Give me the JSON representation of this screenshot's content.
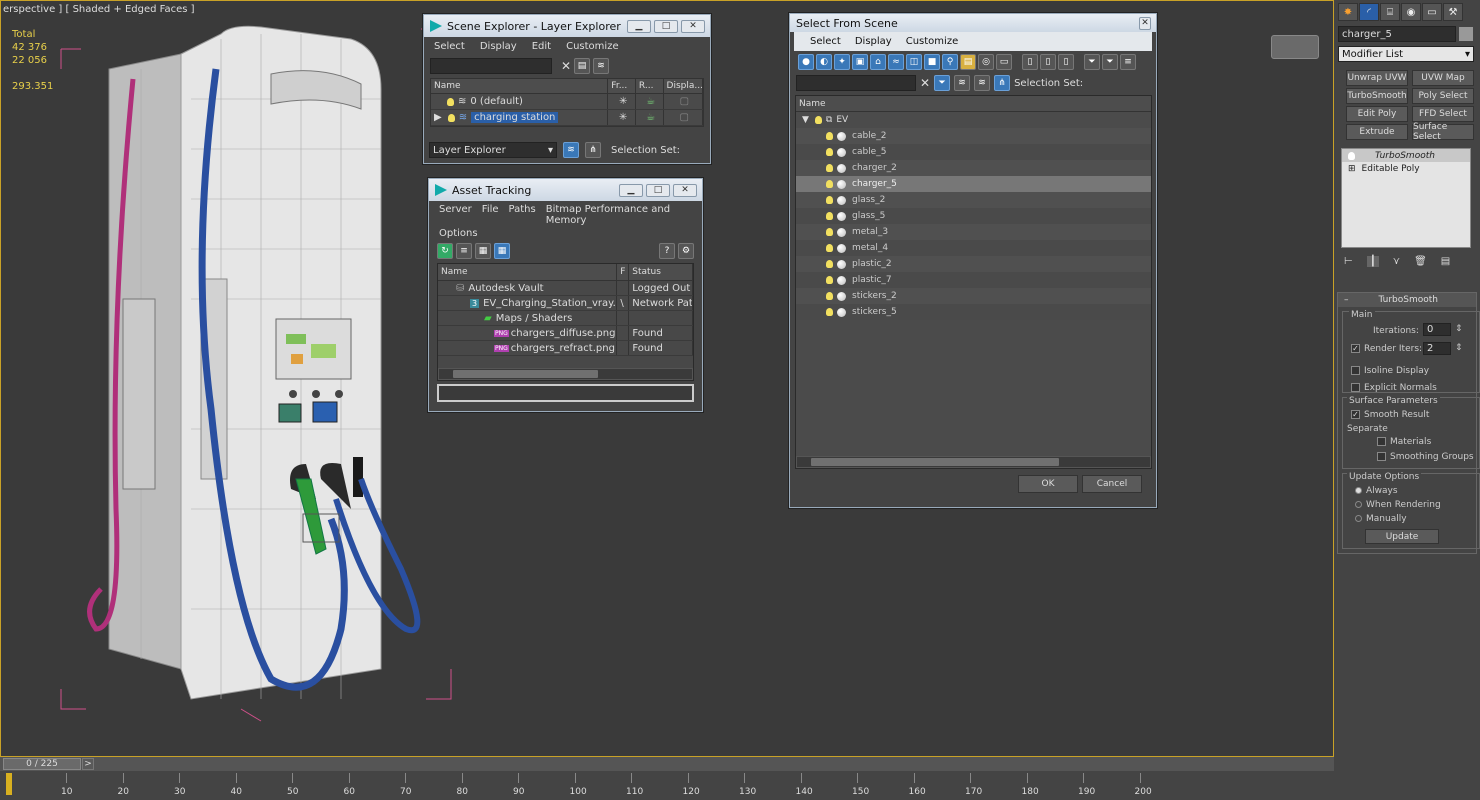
{
  "viewport": {
    "label": "erspective ] [ Shaded + Edged Faces ]",
    "stats": {
      "total_label": "Total",
      "polys": "42 376",
      "verts": "22 056",
      "fps": "293.351"
    }
  },
  "scene_explorer": {
    "title": "Scene Explorer - Layer Explorer",
    "menu": [
      "Select",
      "Display",
      "Edit",
      "Customize"
    ],
    "columns": [
      "Name",
      "Fr...",
      "R...",
      "Displa..."
    ],
    "rows": [
      {
        "name": "0 (default)",
        "selected": false
      },
      {
        "name": "charging station",
        "selected": true
      }
    ],
    "footer_dropdown": "Layer Explorer",
    "selection_set_label": "Selection Set:"
  },
  "asset_tracking": {
    "title": "Asset Tracking",
    "menu": [
      "Server",
      "File",
      "Paths",
      "Bitmap Performance and Memory"
    ],
    "menu2": "Options",
    "columns": [
      "Name",
      "F",
      "Status"
    ],
    "rows": [
      {
        "name": "Autodesk Vault",
        "f": "",
        "status": "Logged Out ..."
      },
      {
        "name": "EV_Charging_Station_vray.max",
        "f": "\\",
        "status": "Network Path"
      },
      {
        "name": "Maps / Shaders",
        "f": "",
        "status": ""
      },
      {
        "name": "chargers_diffuse.png",
        "f": "",
        "status": "Found"
      },
      {
        "name": "chargers_refract.png",
        "f": "",
        "status": "Found"
      }
    ],
    "png_badge": "PNG"
  },
  "select_from_scene": {
    "title": "Select From Scene",
    "menu": [
      "Select",
      "Display",
      "Customize"
    ],
    "selection_set_label": "Selection Set:",
    "name_header": "Name",
    "root": "EV",
    "items": [
      "cable_2",
      "cable_5",
      "charger_2",
      "charger_5",
      "glass_2",
      "glass_5",
      "metal_3",
      "metal_4",
      "plastic_2",
      "plastic_7",
      "stickers_2",
      "stickers_5"
    ],
    "selected_item": "charger_5",
    "ok": "OK",
    "cancel": "Cancel"
  },
  "command_panel": {
    "object_name": "charger_5",
    "modifier_list": "Modifier List",
    "buttons": [
      "Unwrap UVW",
      "UVW Map",
      "TurboSmooth",
      "Poly Select",
      "Edit Poly",
      "FFD Select",
      "Extrude",
      "Surface Select"
    ],
    "stack": [
      "TurboSmooth",
      "Editable Poly"
    ],
    "rollout_title": "TurboSmooth",
    "main_label": "Main",
    "iterations_label": "Iterations:",
    "iterations": "0",
    "render_iters_label": "Render Iters:",
    "render_iters": "2",
    "isoline": "Isoline Display",
    "explicit_normals": "Explicit Normals",
    "surface_params": "Surface Parameters",
    "smooth_result": "Smooth Result",
    "separate": "Separate",
    "materials": "Materials",
    "smoothing_groups": "Smoothing Groups",
    "update_options": "Update Options",
    "always": "Always",
    "when_rendering": "When Rendering",
    "manually": "Manually",
    "update": "Update"
  },
  "timeline": {
    "frame": "0 / 225",
    "next": ">",
    "ticks": [
      "10",
      "20",
      "30",
      "40",
      "50",
      "60",
      "70",
      "80",
      "90",
      "100",
      "110",
      "120",
      "130",
      "140",
      "150",
      "160",
      "170",
      "180",
      "190",
      "200"
    ]
  }
}
